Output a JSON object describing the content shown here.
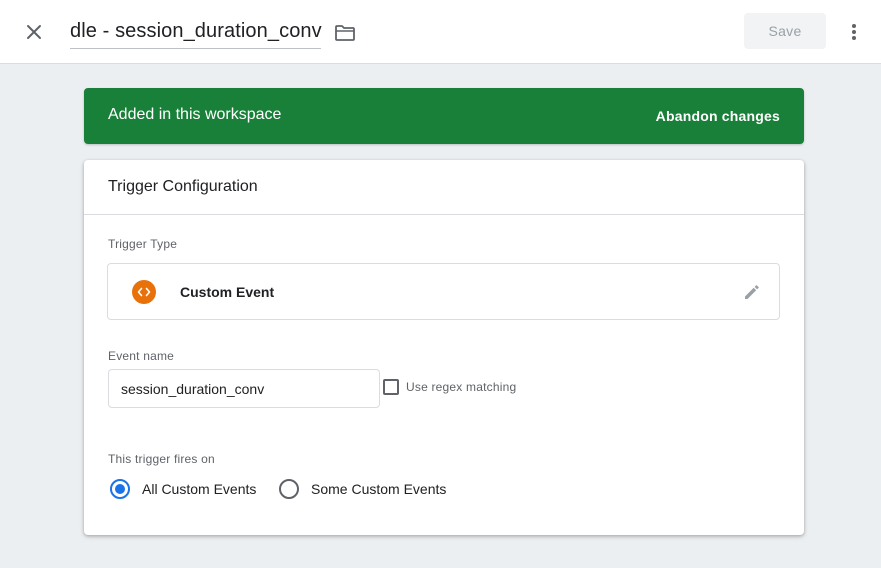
{
  "header": {
    "title": "dle - session_duration_conv",
    "save_label": "Save"
  },
  "banner": {
    "message": "Added in this workspace",
    "action": "Abandon changes",
    "color": "#188038"
  },
  "card": {
    "title": "Trigger Configuration",
    "trigger_type": {
      "label": "Trigger Type",
      "name": "Custom Event",
      "icon": "code-brackets-icon",
      "icon_color": "#e8710a"
    },
    "event_name": {
      "label": "Event name",
      "value": "session_duration_conv",
      "regex_label": "Use regex matching",
      "regex_checked": false
    },
    "fires_on": {
      "label": "This trigger fires on",
      "options": [
        {
          "label": "All Custom Events",
          "selected": true
        },
        {
          "label": "Some Custom Events",
          "selected": false
        }
      ]
    }
  },
  "colors": {
    "accent": "#1a73e8",
    "background": "#eceff1"
  }
}
